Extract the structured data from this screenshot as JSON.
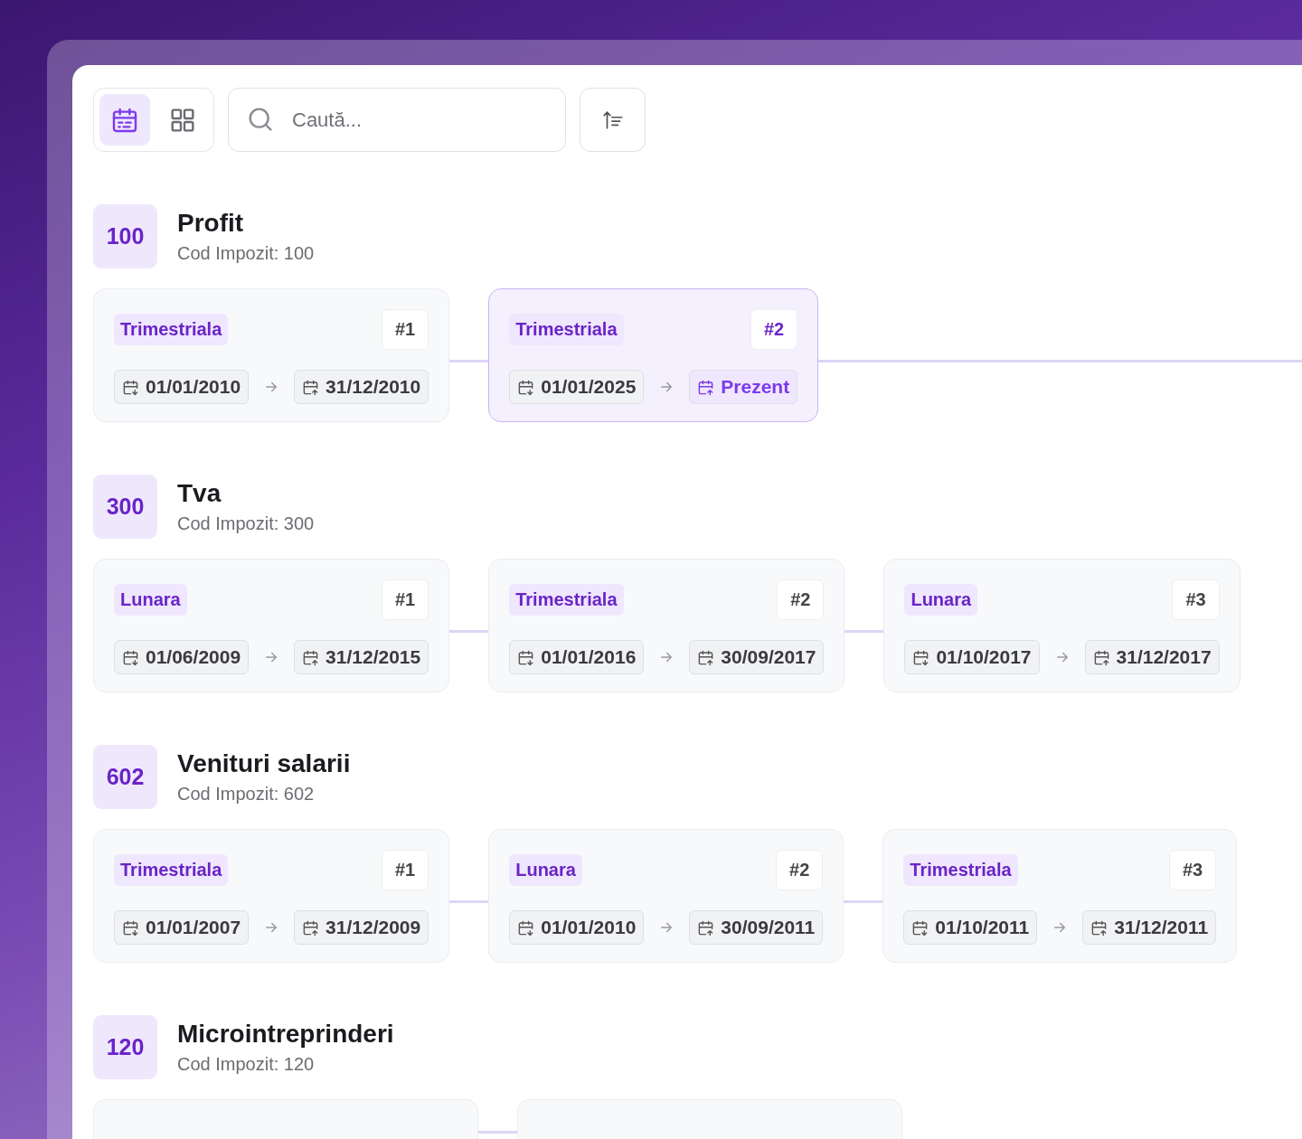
{
  "toolbar": {
    "views": [
      {
        "kind": "calendar",
        "selected": true
      },
      {
        "kind": "grid",
        "selected": false
      }
    ],
    "search": {
      "placeholder": "Caută..."
    }
  },
  "sections": [
    {
      "code": "100",
      "title": "Profit",
      "subtitle": "Cod Impozit: 100",
      "periods": [
        {
          "type": "Trimestriala",
          "index": "#1",
          "start": "01/01/2010",
          "end": "31/12/2010",
          "current": false
        },
        {
          "type": "Trimestriala",
          "index": "#2",
          "start": "01/01/2025",
          "end": "Prezent",
          "current": true
        }
      ]
    },
    {
      "code": "300",
      "title": "Tva",
      "subtitle": "Cod Impozit: 300",
      "periods": [
        {
          "type": "Lunara",
          "index": "#1",
          "start": "01/06/2009",
          "end": "31/12/2015",
          "current": false
        },
        {
          "type": "Trimestriala",
          "index": "#2",
          "start": "01/01/2016",
          "end": "30/09/2017",
          "current": false
        },
        {
          "type": "Lunara",
          "index": "#3",
          "start": "01/10/2017",
          "end": "31/12/2017",
          "current": false
        }
      ]
    },
    {
      "code": "602",
      "title": "Venituri salarii",
      "subtitle": "Cod Impozit: 602",
      "periods": [
        {
          "type": "Trimestriala",
          "index": "#1",
          "start": "01/01/2007",
          "end": "31/12/2009",
          "current": false
        },
        {
          "type": "Lunara",
          "index": "#2",
          "start": "01/01/2010",
          "end": "30/09/2011",
          "current": false
        },
        {
          "type": "Trimestriala",
          "index": "#3",
          "start": "01/10/2011",
          "end": "31/12/2011",
          "current": false
        }
      ]
    },
    {
      "code": "120",
      "title": "Microintreprinderi",
      "subtitle": "Cod Impozit: 120",
      "periods": [
        {
          "current": false
        },
        {
          "current": false
        }
      ]
    }
  ]
}
